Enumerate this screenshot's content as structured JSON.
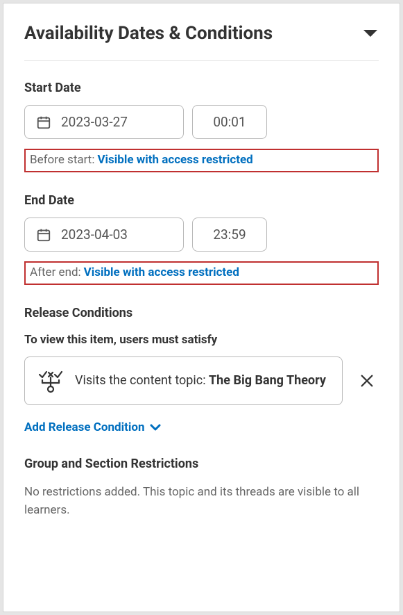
{
  "panel": {
    "title": "Availability Dates & Conditions"
  },
  "start": {
    "label": "Start Date",
    "date": "2023-03-27",
    "time": "00:01",
    "prefix": "Before start:",
    "status": "Visible with access restricted"
  },
  "end": {
    "label": "End Date",
    "date": "2023-04-03",
    "time": "23:59",
    "prefix": "After end:",
    "status": "Visible with access restricted"
  },
  "release": {
    "heading": "Release Conditions",
    "sub": "To view this item, users must satisfy",
    "condition_prefix": "Visits the content topic: ",
    "condition_name": "The Big Bang Theory",
    "add_label": "Add Release Condition"
  },
  "group": {
    "heading": "Group and Section Restrictions",
    "empty": "No restrictions added. This topic and its threads are visible to all learners."
  }
}
